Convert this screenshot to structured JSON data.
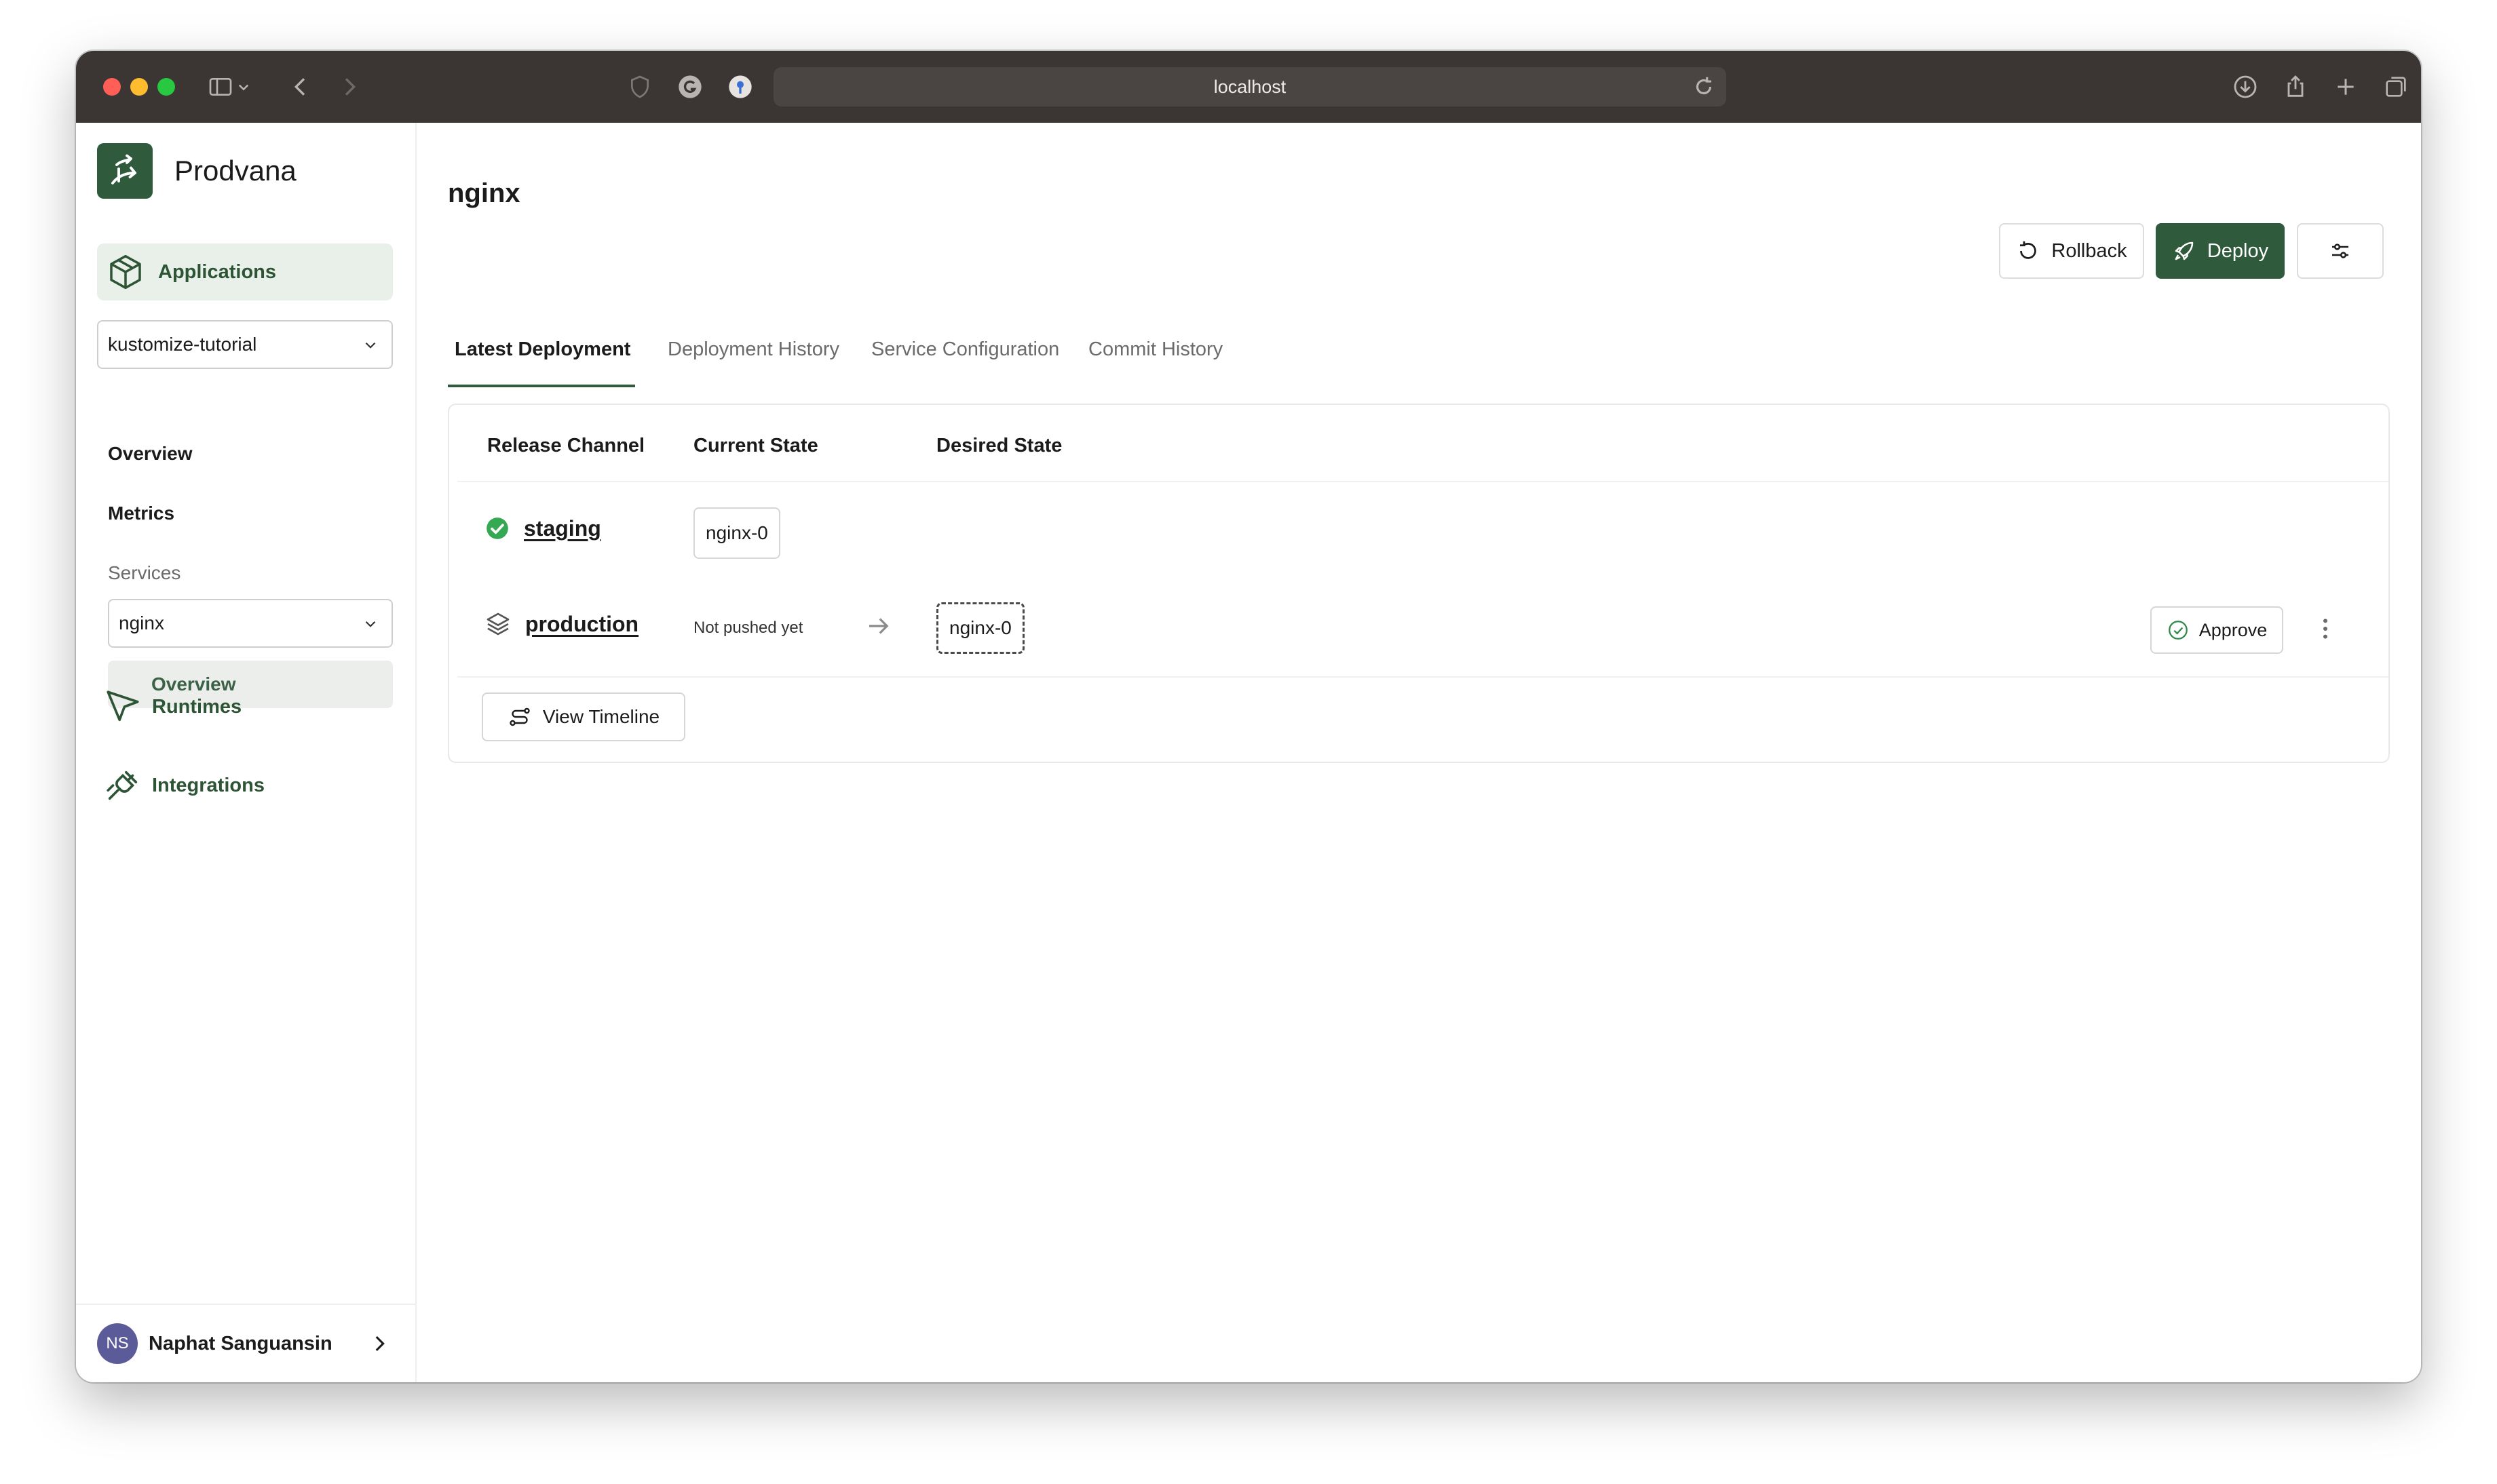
{
  "browser": {
    "url": "localhost"
  },
  "sidebar": {
    "brand": "Prodvana",
    "applications_label": "Applications",
    "application_select": "kustomize-tutorial",
    "overview_label": "Overview",
    "metrics_label": "Metrics",
    "services_heading": "Services",
    "service_select": "nginx",
    "service_overview_label": "Overview",
    "runtimes_label": "Runtimes",
    "integrations_label": "Integrations",
    "user": {
      "initials": "NS",
      "name": "Naphat Sanguansin"
    }
  },
  "main": {
    "title": "nginx",
    "actions": {
      "rollback_label": "Rollback",
      "deploy_label": "Deploy"
    },
    "tabs": [
      {
        "label": "Latest Deployment",
        "active": true
      },
      {
        "label": "Deployment History",
        "active": false
      },
      {
        "label": "Service Configuration",
        "active": false
      },
      {
        "label": "Commit History",
        "active": false
      }
    ],
    "table": {
      "headers": [
        "Release Channel",
        "Current State",
        "Desired State"
      ],
      "rows": [
        {
          "channel": "staging",
          "status": "success",
          "current": "nginx-0"
        },
        {
          "channel": "production",
          "status": "pending",
          "current": "Not pushed yet",
          "desired": "nginx-0",
          "approve_label": "Approve"
        }
      ],
      "view_timeline_label": "View Timeline"
    }
  },
  "colors": {
    "brand_green": "#2f5a3c",
    "active_nav_bg": "#e8f0e9",
    "success_green": "#34a853",
    "titlebar": "#3b3634"
  }
}
